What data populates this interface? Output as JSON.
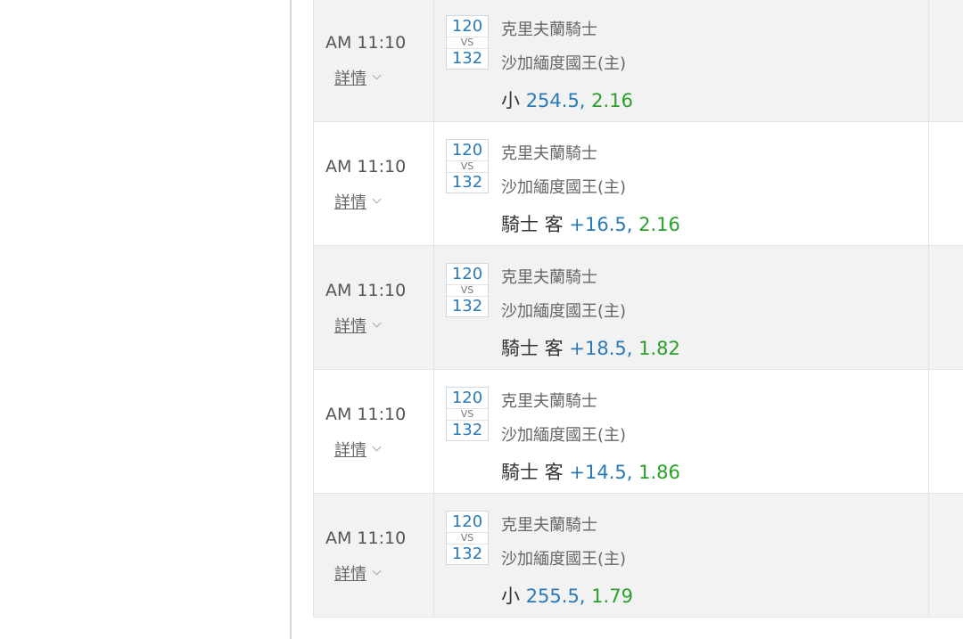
{
  "bets": [
    {
      "time": "AM 11:10",
      "details_label": "詳情",
      "score_away": "120",
      "vs_label": "VS",
      "score_home": "132",
      "away_team": "克里夫蘭騎士",
      "home_team": "沙加緬度國王(主)",
      "pick_side": "小",
      "pick_line": "254.5,",
      "pick_odds": "2.16"
    },
    {
      "time": "AM 11:10",
      "details_label": "詳情",
      "score_away": "120",
      "vs_label": "VS",
      "score_home": "132",
      "away_team": "克里夫蘭騎士",
      "home_team": "沙加緬度國王(主)",
      "pick_side": "騎士 客",
      "pick_line": "+16.5,",
      "pick_odds": "2.16"
    },
    {
      "time": "AM 11:10",
      "details_label": "詳情",
      "score_away": "120",
      "vs_label": "VS",
      "score_home": "132",
      "away_team": "克里夫蘭騎士",
      "home_team": "沙加緬度國王(主)",
      "pick_side": "騎士 客",
      "pick_line": "+18.5,",
      "pick_odds": "1.82"
    },
    {
      "time": "AM 11:10",
      "details_label": "詳情",
      "score_away": "120",
      "vs_label": "VS",
      "score_home": "132",
      "away_team": "克里夫蘭騎士",
      "home_team": "沙加緬度國王(主)",
      "pick_side": "騎士 客",
      "pick_line": "+14.5,",
      "pick_odds": "1.86"
    },
    {
      "time": "AM 11:10",
      "details_label": "詳情",
      "score_away": "120",
      "vs_label": "VS",
      "score_home": "132",
      "away_team": "克里夫蘭騎士",
      "home_team": "沙加緬度國王(主)",
      "pick_side": "小",
      "pick_line": "255.5,",
      "pick_odds": "1.79"
    }
  ],
  "icons": {
    "details_toggle": "chevron-down-icon"
  },
  "colors": {
    "line_blue": "#2a7ab8",
    "odds_green": "#2aa02a",
    "row_shaded": "#f2f2f2"
  }
}
